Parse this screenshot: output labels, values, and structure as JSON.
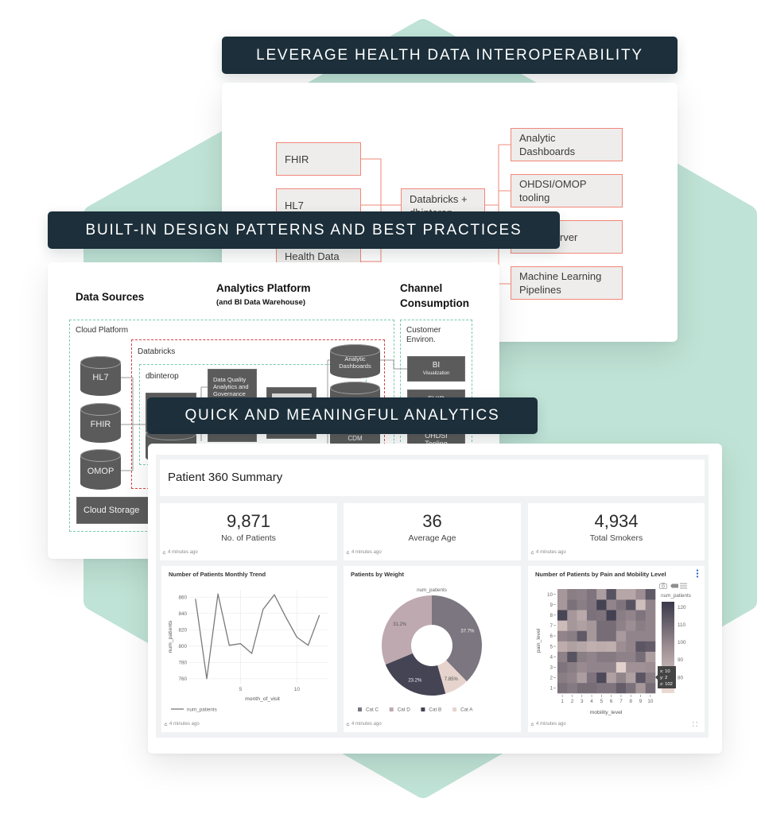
{
  "banners": {
    "interoperability": "LEVERAGE HEALTH DATA INTEROPERABILITY",
    "design_patterns": "BUILT-IN DESIGN PATTERNS AND BEST PRACTICES",
    "analytics": "QUICK AND MEANINGFUL ANALYTICS"
  },
  "theme": {
    "hexagon": "#bfe3d6",
    "banner_bg": "#1c2f3a"
  },
  "interop_diagram": {
    "sources": [
      {
        "label": "FHIR"
      },
      {
        "label": "HL7"
      },
      {
        "label": "Health Data"
      }
    ],
    "hub": {
      "line1": "Databricks +",
      "line2": "dbinterop"
    },
    "outputs": [
      {
        "line1": "Analytic",
        "line2": "Dashboards"
      },
      {
        "line1": "OHDSI/OMOP",
        "line2": "tooling"
      },
      {
        "line1": "rver",
        "line2": ""
      },
      {
        "line1": "Machine Learning",
        "line2": "Pipelines"
      }
    ],
    "colors": {
      "box_border": "#f2877a",
      "box_fill": "#eeedeb",
      "connector": "#f3a294"
    }
  },
  "architecture": {
    "headings": {
      "data_sources": "Data Sources",
      "analytics_platform": "Analytics Platform",
      "analytics_platform_sub": "(and BI Data Warehouse)",
      "channel": "Channel",
      "consumption": "Consumption"
    },
    "zones": {
      "cloud_platform": "Cloud Platform",
      "databricks": "Databricks",
      "dbinterop": "dbinterop",
      "customer": "Customer",
      "environ": "Environ."
    },
    "source_stores": [
      "HL7",
      "FHIR",
      "OMOP"
    ],
    "cloud_storage": "Cloud Storage",
    "data_quality": {
      "line1": "Data Quality",
      "line2": "Analytics and",
      "line3": "Governance"
    },
    "analytic_dashboards": {
      "line1": "Analytic",
      "line2": "Dashboards"
    },
    "cdm": "CDM",
    "bi": {
      "title": "BI",
      "subtitle": "Visualization"
    },
    "fhir_channel": "FHIR",
    "ohdsi_channel": {
      "line1": "OHDSI",
      "line2": "Tooling"
    },
    "colors": {
      "zone_green": "#79c9ad",
      "zone_red": "#d8433e",
      "store": "#5b5b5b"
    }
  },
  "dashboard": {
    "title": "Patient 360 Summary",
    "kpis": [
      {
        "value": "9,871",
        "label": "No. of Patients",
        "updated": "4 minutes ago"
      },
      {
        "value": "36",
        "label": "Average Age",
        "updated": "4 minutes ago"
      },
      {
        "value": "4,934",
        "label": "Total Smokers",
        "updated": "4 minutes ago"
      }
    ],
    "charts": [
      {
        "title": "Number of Patients Monthly Trend",
        "updated": "4 minutes ago"
      },
      {
        "title": "Patients by Weight",
        "updated": "4 minutes ago"
      },
      {
        "title": "Number of Patients by Pain and Mobility Level",
        "updated": "4 minutes ago"
      }
    ],
    "heatmap_tooltip": {
      "x": "x: 10",
      "y": "y: 2",
      "z": "z: 102"
    },
    "toolbar_icons": [
      "camera-icon",
      "pan-icon",
      "menu-icon"
    ],
    "accent": "#2f6fd6"
  },
  "chart_data": [
    {
      "type": "line",
      "title": "Number of Patients Monthly Trend",
      "x": [
        1,
        2,
        3,
        4,
        5,
        6,
        7,
        8,
        9,
        10,
        11,
        12
      ],
      "series": [
        {
          "name": "num_patients",
          "values": [
            858,
            760,
            864,
            801,
            803,
            791,
            845,
            863,
            836,
            811,
            801,
            838
          ],
          "color": "#7a7a7a"
        }
      ],
      "xlabel": "month_of_visit",
      "ylabel": "num_patients",
      "xticks": [
        5,
        10
      ],
      "yticks": [
        760,
        780,
        800,
        820,
        840,
        860
      ],
      "xlim": [
        0.45,
        12.8
      ],
      "ylim": [
        754,
        869
      ],
      "grid": true,
      "legend": "bottom-left"
    },
    {
      "type": "pie",
      "title": "Patients by Weight",
      "subtitle": "num_patients",
      "hole": true,
      "slices": [
        {
          "label": "Cat C",
          "value": 37.7,
          "text": "37.7%",
          "color": "#7b7680"
        },
        {
          "label": "Cat A",
          "value": 7.85,
          "text": "7.85%",
          "color": "#e6d3cd"
        },
        {
          "label": "Cat B",
          "value": 23.2,
          "text": "23.2%",
          "color": "#444455"
        },
        {
          "label": "Cat D",
          "value": 31.2,
          "text": "31.2%",
          "color": "#bea9b0"
        }
      ],
      "legend_order": [
        "Cat C",
        "Cat D",
        "Cat B",
        "Cat A"
      ],
      "legend": "bottom"
    },
    {
      "type": "heatmap",
      "title": "Number of Patients by Pain and Mobility Level",
      "x": [
        1,
        2,
        3,
        4,
        5,
        6,
        7,
        8,
        9,
        10
      ],
      "y": [
        1,
        2,
        3,
        4,
        5,
        6,
        7,
        8,
        9,
        10
      ],
      "xlabel": "mobility_level",
      "ylabel": "pain_level",
      "z": [
        [
          106,
          103,
          107,
          107,
          105,
          105,
          112,
          106,
          94,
          107
        ],
        [
          102,
          100,
          92,
          105,
          118,
          91,
          100,
          91,
          114,
          102
        ],
        [
          105,
          102,
          98,
          100,
          100,
          100,
          75,
          96,
          96,
          97
        ],
        [
          101,
          115,
          102,
          100,
          103,
          103,
          101,
          101,
          107,
          92
        ],
        [
          87,
          91,
          89,
          86,
          87,
          86,
          97,
          100,
          114,
          112
        ],
        [
          100,
          102,
          113,
          94,
          107,
          107,
          93,
          100,
          100,
          100
        ],
        [
          82,
          94,
          91,
          94,
          107,
          107,
          101,
          97,
          102,
          100
        ],
        [
          119,
          94,
          88,
          106,
          105,
          121,
          102,
          100,
          105,
          100
        ],
        [
          94,
          106,
          102,
          105,
          120,
          100,
          105,
          115,
          81,
          100
        ],
        [
          94,
          102,
          101,
          105,
          92,
          115,
          89,
          89,
          97,
          113
        ]
      ],
      "colorbar": {
        "title": "num_patients",
        "ticks": [
          80,
          90,
          100,
          110,
          120
        ]
      },
      "zlim": [
        71,
        123
      ],
      "colorscale": [
        [
          0,
          "#eddcd5"
        ],
        [
          0.5,
          "#9d8e93"
        ],
        [
          1,
          "#3a394b"
        ]
      ]
    }
  ]
}
